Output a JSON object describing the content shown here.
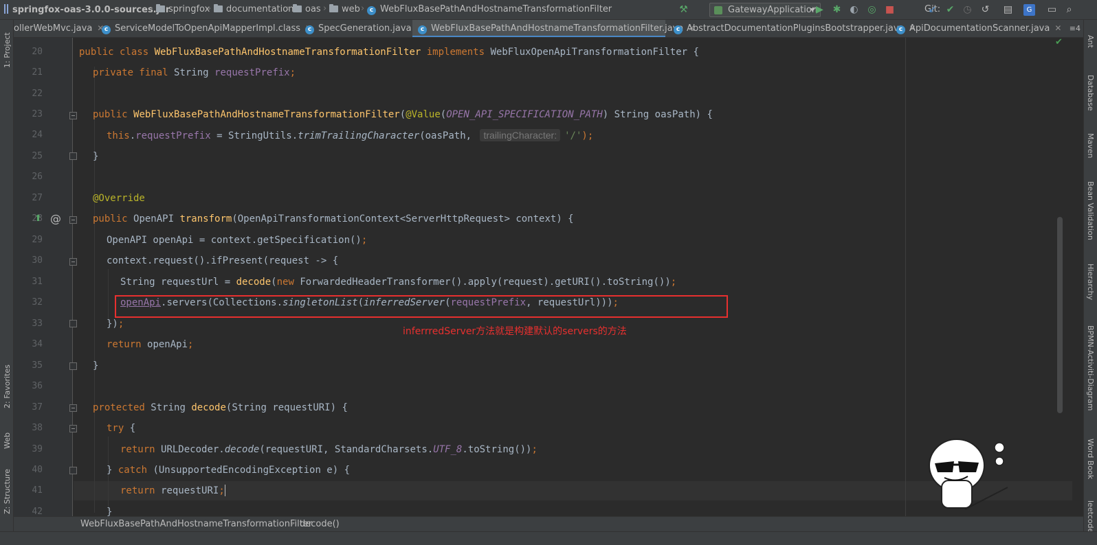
{
  "breadcrumb": {
    "jar": "springfox-oas-3.0.0-sources.jar",
    "folders": [
      "springfox",
      "documentation",
      "oas",
      "web"
    ],
    "class": "WebFluxBasePathAndHostnameTransformationFilter"
  },
  "toolbar": {
    "run_config": "GatewayApplication",
    "vcs_label": "Git:"
  },
  "tabs": [
    {
      "label": "ollerWebMvc.java",
      "active": false
    },
    {
      "label": "ServiceModelToOpenApiMapperImpl.class",
      "active": false
    },
    {
      "label": "SpecGeneration.java",
      "active": false
    },
    {
      "label": "WebFluxBasePathAndHostnameTransformationFilter.java",
      "active": true
    },
    {
      "label": "AbstractDocumentationPluginsBootstrapper.java",
      "active": false
    },
    {
      "label": "ApiDocumentationScanner.java",
      "active": false
    }
  ],
  "tab_overflow_count": "4",
  "left_tools": [
    "1: Project",
    "2: Favorites",
    "Web",
    "Z: Structure"
  ],
  "right_tools": [
    "Ant",
    "Database",
    "Maven",
    "Bean Validation",
    "Hierarchy",
    "BPMN-Activiti-Diagram",
    "Word Book",
    "leetcode"
  ],
  "code": {
    "line_numbers": [
      "20",
      "21",
      "22",
      "23",
      "24",
      "25",
      "26",
      "27",
      "28",
      "29",
      "30",
      "31",
      "32",
      "33",
      "34",
      "35",
      "36",
      "37",
      "38",
      "39",
      "40",
      "41",
      "42"
    ],
    "l20": {
      "kw1": "public class ",
      "name": "WebFluxBasePathAndHostnameTransformationFilter",
      "kw2": " implements ",
      "iface": "WebFluxOpenApiTransformationFilter {"
    },
    "l21": {
      "kw": "private final ",
      "type": "String ",
      "field": "requestPrefix",
      "end": ";"
    },
    "l23": {
      "kw": "public ",
      "name": "WebFluxBasePathAndHostnameTransformationFilter",
      "p1": "(",
      "ann": "@Value",
      "p2": "(",
      "const": "OPEN_API_SPECIFICATION_PATH",
      "p3": ") String oasPath) {"
    },
    "l24": {
      "kw": "this",
      "dot": ".",
      "field": "requestPrefix",
      "mid": " = StringUtils.",
      "method": "trimTrailingCharacter",
      "args": "(oasPath, ",
      "hint": "trailingCharacter:",
      "str": "'/'",
      "end": ");"
    },
    "l25": "}",
    "l27": "@Override",
    "l28": {
      "kw": "public ",
      "type": "OpenAPI ",
      "name": "transform",
      "rest": "(OpenApiTransformationContext<ServerHttpRequest> context) {"
    },
    "l29": {
      "text": "OpenAPI openApi = context.getSpecification()",
      "end": ";"
    },
    "l30": "context.request().ifPresent(request -> {",
    "l31": {
      "a": "String requestUrl = ",
      "fn": "decode",
      "b": "(",
      "kw": "new ",
      "c": "ForwardedHeaderTransformer().apply(request).getURI().toString())",
      "end": ";"
    },
    "l32": {
      "var": "openApi",
      "a": ".servers(Collections.",
      "m1": "singletonList",
      "b": "(",
      "m2": "inferredServer",
      "c": "(",
      "field": "requestPrefix",
      "d": ", requestUrl)))",
      "end": ";"
    },
    "l33": {
      "text": "})",
      "end": ";"
    },
    "l34": {
      "kw": "return ",
      "text": "openApi",
      "end": ";"
    },
    "l35": "}",
    "l37": {
      "kw": "protected ",
      "type": "String ",
      "name": "decode",
      "rest": "(String requestURI) {"
    },
    "l38": {
      "kw": "try ",
      "rest": "{"
    },
    "l39": {
      "kw": "return ",
      "a": "URLDecoder.",
      "m": "decode",
      "b": "(requestURI, StandardCharsets.",
      "const": "UTF_8",
      "c": ".toString())",
      "end": ";"
    },
    "l40": {
      "a": "} ",
      "kw": "catch ",
      "b": "(UnsupportedEncodingException e) {"
    },
    "l41": {
      "kw": "return ",
      "text": "requestURI",
      "end": ";"
    },
    "l42": "}"
  },
  "annotation_note": "inferrredServer方法就是构建默认的servers的方法",
  "status": {
    "class": "WebFluxBasePathAndHostnameTransformationFilter",
    "method": "decode()"
  },
  "colors": {
    "accent": "#4a88c7",
    "annotation_red": "#e8302f",
    "keyword": "#cc7832",
    "method": "#ffc66d",
    "field": "#9876aa"
  }
}
